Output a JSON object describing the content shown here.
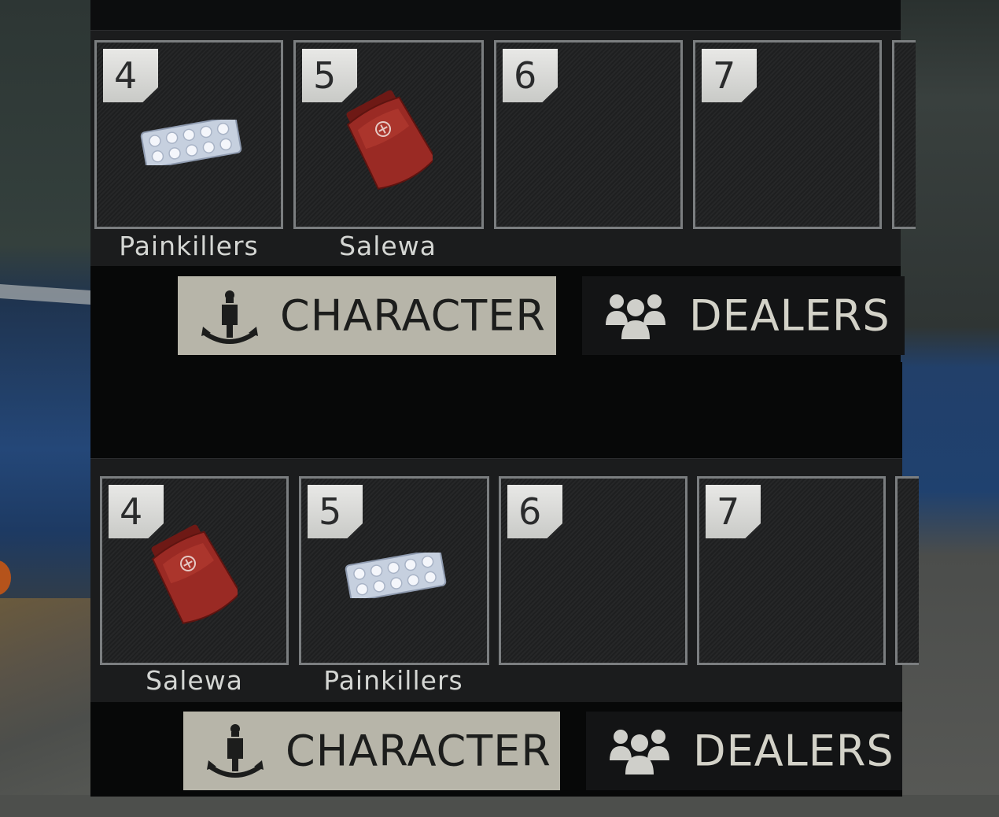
{
  "panels": [
    {
      "slots": [
        {
          "number": "4",
          "item": "painkillers-icon",
          "label": "Painkillers"
        },
        {
          "number": "5",
          "item": "salewa-icon",
          "label": "Salewa"
        },
        {
          "number": "6",
          "item": "",
          "label": ""
        },
        {
          "number": "7",
          "item": "",
          "label": ""
        }
      ],
      "tabs": [
        {
          "label": "CHARACTER",
          "icon": "character-icon",
          "active": true
        },
        {
          "label": "DEALERS",
          "icon": "dealers-icon",
          "active": false
        }
      ]
    },
    {
      "slots": [
        {
          "number": "4",
          "item": "salewa-icon",
          "label": "Salewa"
        },
        {
          "number": "5",
          "item": "painkillers-icon",
          "label": "Painkillers"
        },
        {
          "number": "6",
          "item": "",
          "label": ""
        },
        {
          "number": "7",
          "item": "",
          "label": ""
        }
      ],
      "tabs": [
        {
          "label": "CHARACTER",
          "icon": "character-icon",
          "active": true
        },
        {
          "label": "DEALERS",
          "icon": "dealers-icon",
          "active": false
        }
      ]
    }
  ],
  "colors": {
    "active_tab": "#b7b5a9",
    "inactive_tab": "#131415",
    "slot_border": "#7b7e80",
    "medkit_red": "#9a2a24"
  }
}
